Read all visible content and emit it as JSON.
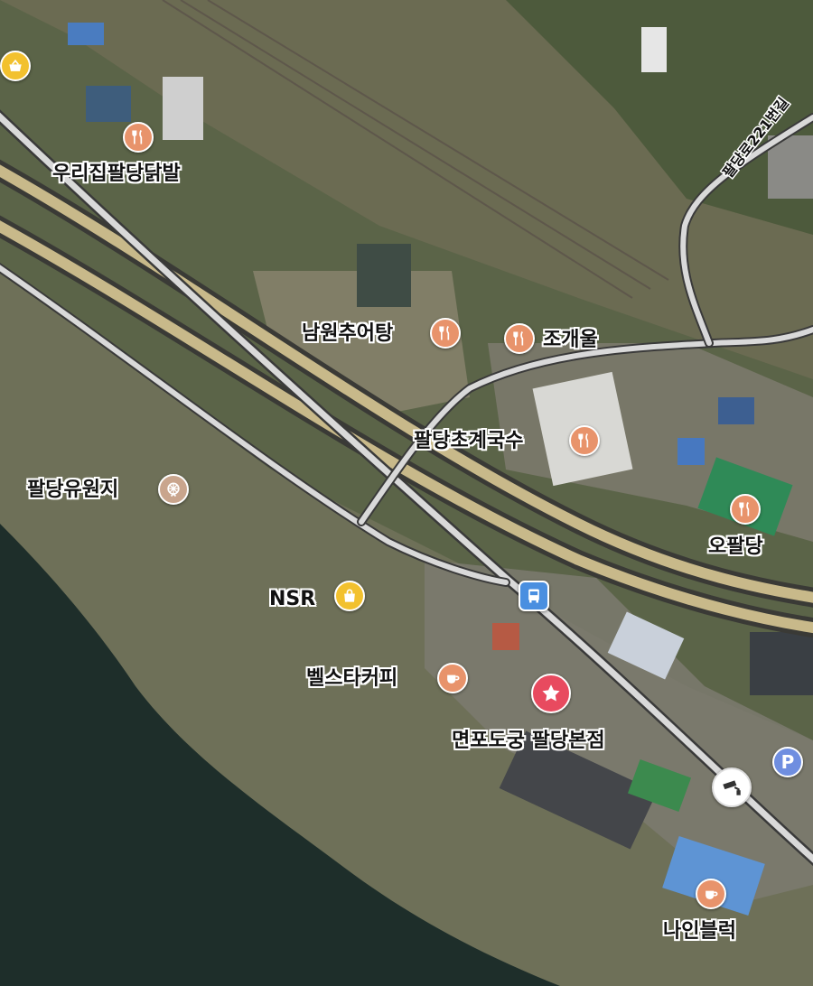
{
  "map": {
    "colors": {
      "water": "#1e2e2a",
      "land": "#5b6448",
      "brush": "#6e7058",
      "highway_fill": "#c8b98a",
      "highway_edge": "#3a3a36",
      "road_fill": "#d9d9d9",
      "road_edge": "#3a3a3a",
      "restaurant": "#e8936b",
      "cafe": "#e8936b",
      "shopping": "#f2c12e",
      "leisure": "#c9a58d",
      "bus": "#4a8fe0",
      "parking": "#6f8ee0",
      "cctv": "#333333",
      "featured": "#e84a5f"
    },
    "road_label": "팔당로221번길",
    "pois": [
      {
        "id": "uri",
        "name": "우리집팔당닭발",
        "icon": "fork-knife-icon",
        "category": "restaurant"
      },
      {
        "id": "namwon",
        "name": "남원추어탕",
        "icon": "fork-knife-icon",
        "category": "restaurant"
      },
      {
        "id": "jogae",
        "name": "조개울",
        "icon": "fork-knife-icon",
        "category": "restaurant"
      },
      {
        "id": "chogye",
        "name": "팔당초계국수",
        "icon": "fork-knife-icon",
        "category": "restaurant"
      },
      {
        "id": "park",
        "name": "팔당유원지",
        "icon": "ferris-wheel-icon",
        "category": "leisure"
      },
      {
        "id": "opaldang",
        "name": "오팔당",
        "icon": "fork-knife-icon",
        "category": "restaurant"
      },
      {
        "id": "nsr",
        "name": "NSR",
        "icon": "shopping-bag-icon",
        "category": "shopping"
      },
      {
        "id": "bellstar",
        "name": "벨스타커피",
        "icon": "coffee-cup-icon",
        "category": "cafe"
      },
      {
        "id": "myeonpo",
        "name": "면포도궁 팔당본점",
        "icon": "star-icon",
        "category": "featured"
      },
      {
        "id": "ninebrick",
        "name": "나인블럭",
        "icon": "coffee-cup-icon",
        "category": "cafe"
      }
    ],
    "markers": [
      {
        "id": "bus",
        "icon": "bus-icon"
      },
      {
        "id": "parking",
        "icon": "parking-icon",
        "text": "P"
      },
      {
        "id": "cctv",
        "icon": "cctv-camera-icon"
      },
      {
        "id": "topleft-shop",
        "icon": "shopping-basket-icon"
      }
    ]
  }
}
